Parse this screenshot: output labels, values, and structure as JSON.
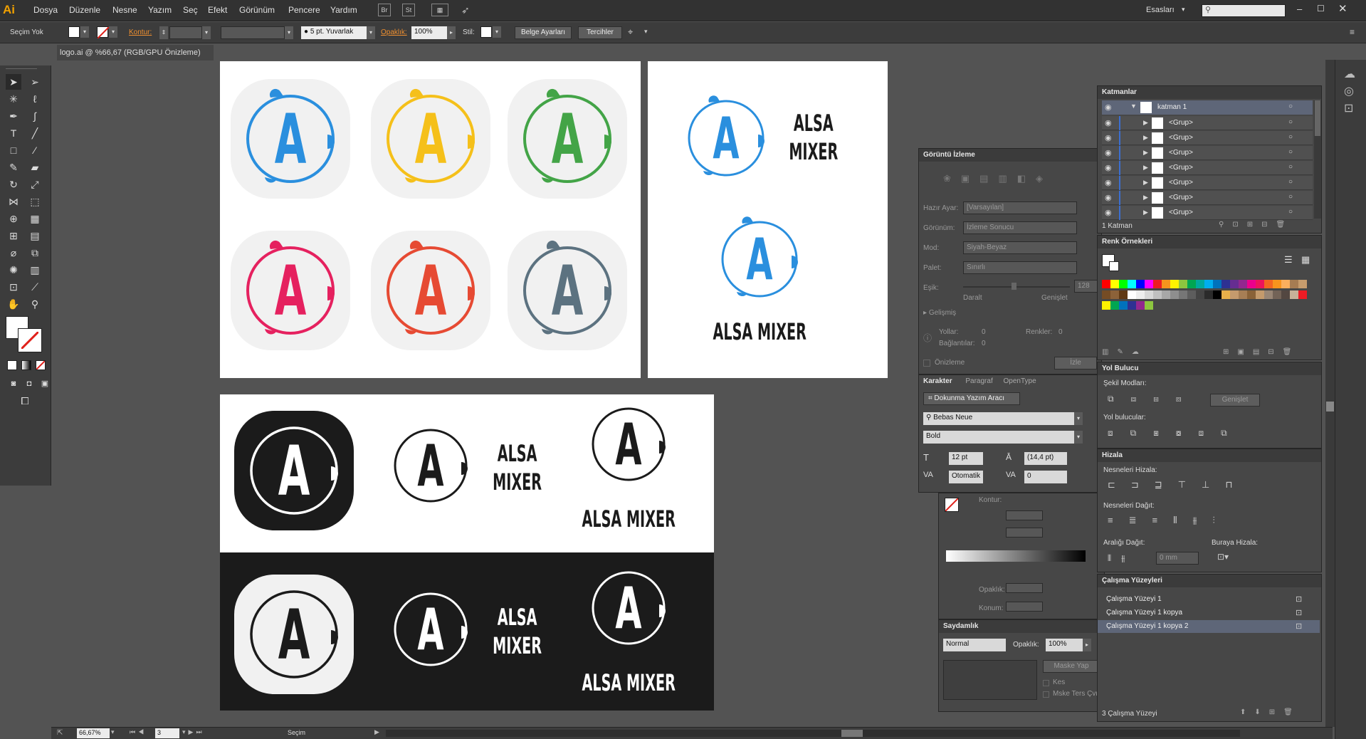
{
  "app": {
    "logo": "Ai",
    "workspace": "Esasları"
  },
  "menu": [
    "Dosya",
    "Düzenle",
    "Nesne",
    "Yazım",
    "Seç",
    "Efekt",
    "Görünüm",
    "Pencere",
    "Yardım"
  ],
  "menu_buttons": [
    "Br",
    "St"
  ],
  "options": {
    "selection": "Seçim Yok",
    "stroke_label": "Kontur:",
    "brush": "5 pt. Yuvarlak",
    "opacity_label": "Opaklık:",
    "opacity": "100%",
    "style_label": "Stil:",
    "doc_setup": "Belge Ayarları",
    "preferences": "Tercihler"
  },
  "document": {
    "tab": "logo.ai @ %66,67 (RGB/GPU Önizleme)"
  },
  "logo": {
    "letter": "A",
    "name1": "ALSA",
    "name2": "MIXER",
    "full": "ALSA MIXER"
  },
  "colors": {
    "blue": "#2a8fde",
    "yellow": "#f5c01a",
    "green": "#43a447",
    "pink": "#e5215f",
    "red": "#e64a33",
    "slate": "#5c7280",
    "dark": "#1b1b1b"
  },
  "layers": {
    "title": "Katmanlar",
    "root": "katman 1",
    "items": [
      "<Grup>",
      "<Grup>",
      "<Grup>",
      "<Grup>",
      "<Grup>",
      "<Grup>",
      "<Grup>"
    ],
    "count": "1 Katman"
  },
  "swatches": {
    "title": "Renk Örnekleri"
  },
  "pathfinder": {
    "title": "Yol Bulucu",
    "shape_modes": "Şekil Modları:",
    "expand": "Genişlet",
    "pathfinders": "Yol bulucular:"
  },
  "align": {
    "title": "Hizala",
    "align_objects": "Nesneleri Hizala:",
    "distribute_objects": "Nesneleri Dağıt:",
    "distribute_spacing": "Aralığı Dağıt:",
    "align_to": "Buraya Hizala:",
    "spacing": "0 mm"
  },
  "artboards": {
    "title": "Çalışma Yüzeyleri",
    "items": [
      "Çalışma Yüzeyi 1",
      "Çalışma Yüzeyi 1 kopya",
      "Çalışma Yüzeyi 1 kopya 2"
    ],
    "count": "3 Çalışma Yüzeyi"
  },
  "image_trace": {
    "title": "Görüntü İzleme",
    "preset_label": "Hazır Ayar:",
    "preset": "[Varsayılan]",
    "view_label": "Görünüm:",
    "view": "İzleme Sonucu",
    "mode_label": "Mod:",
    "mode": "Siyah-Beyaz",
    "palette_label": "Palet:",
    "palette": "Sınırlı",
    "threshold_label": "Eşik:",
    "threshold": "128",
    "less": "Daralt",
    "more": "Genişlet",
    "advanced": "Gelişmiş",
    "paths_label": "Yollar:",
    "paths": "0",
    "colors_label": "Renkler:",
    "colors": "0",
    "anchors_label": "Bağlantılar:",
    "anchors": "0",
    "preview": "Önizleme",
    "trace": "İzle"
  },
  "character": {
    "tabs": [
      "Karakter",
      "Paragraf",
      "OpenType"
    ],
    "touch_tool": "Dokunma Yazım Aracı",
    "font": "Bebas Neue",
    "style": "Bold",
    "size": "12 pt",
    "leading": "(14,4 pt)",
    "kerning": "Otomatik",
    "tracking": "0"
  },
  "gradient_panel": {
    "stroke_label": "Kontur:",
    "opacity_label": "Opaklık:",
    "location_label": "Konum:"
  },
  "transparency": {
    "title": "Saydamlık",
    "blend": "Normal",
    "opacity_label": "Opaklık:",
    "opacity": "100%",
    "make_mask": "Maske Yap",
    "clip": "Kes",
    "invert": "Mske Ters Çvr"
  },
  "status": {
    "zoom": "66,67%",
    "page": "3",
    "tool": "Seçim"
  }
}
